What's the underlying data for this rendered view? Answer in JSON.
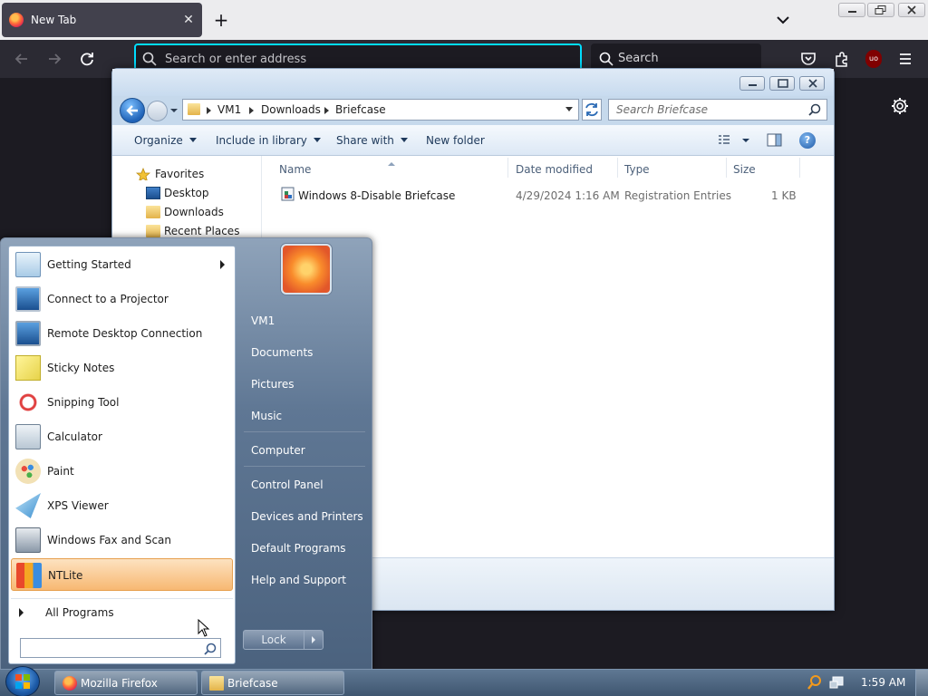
{
  "firefox": {
    "tab_title": "New Tab",
    "url_placeholder": "Search or enter address",
    "search_placeholder": "Search",
    "ublock_badge": "uo"
  },
  "explorer": {
    "breadcrumbs": [
      "VM1",
      "Downloads",
      "Briefcase"
    ],
    "search_placeholder": "Search Briefcase",
    "toolbar": {
      "organize": "Organize",
      "include_in_library": "Include in library",
      "share_with": "Share with",
      "new_folder": "New folder"
    },
    "nav": {
      "favorites": "Favorites",
      "items": [
        "Desktop",
        "Downloads",
        "Recent Places"
      ]
    },
    "columns": {
      "name": "Name",
      "date_modified": "Date modified",
      "type": "Type",
      "size": "Size"
    },
    "files": [
      {
        "name": "Windows 8-Disable Briefcase",
        "date_modified": "4/29/2024 1:16 AM",
        "type": "Registration Entries",
        "size": "1 KB"
      }
    ]
  },
  "start_menu": {
    "programs": [
      {
        "label": "Getting Started",
        "icon": "getting-started-icon",
        "has_submenu": true
      },
      {
        "label": "Connect to a Projector",
        "icon": "projector-icon"
      },
      {
        "label": "Remote Desktop Connection",
        "icon": "remote-desktop-icon"
      },
      {
        "label": "Sticky Notes",
        "icon": "sticky-notes-icon"
      },
      {
        "label": "Snipping Tool",
        "icon": "snipping-tool-icon"
      },
      {
        "label": "Calculator",
        "icon": "calculator-icon"
      },
      {
        "label": "Paint",
        "icon": "paint-icon"
      },
      {
        "label": "XPS Viewer",
        "icon": "xps-viewer-icon"
      },
      {
        "label": "Windows Fax and Scan",
        "icon": "fax-scan-icon"
      },
      {
        "label": "NTLite",
        "icon": "ntlite-icon",
        "highlighted": true
      }
    ],
    "all_programs": "All Programs",
    "search_value": "",
    "right_links": [
      "VM1",
      "Documents",
      "Pictures",
      "Music",
      "Computer",
      "Control Panel",
      "Devices and Printers",
      "Default Programs",
      "Help and Support"
    ],
    "lock_label": "Lock"
  },
  "taskbar": {
    "buttons": [
      "Mozilla Firefox",
      "Briefcase"
    ],
    "clock": "1:59 AM"
  },
  "colors": {
    "firefox_focus_ring": "#00ddff",
    "ntlite_highlight": "#f7b872",
    "taskbar": "#4a6380"
  }
}
